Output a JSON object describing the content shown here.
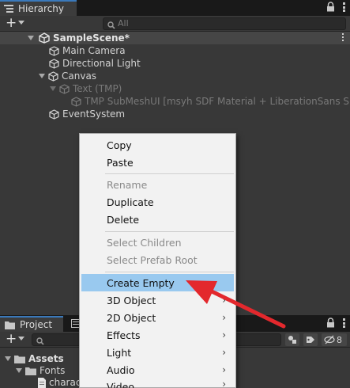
{
  "hierarchy": {
    "tab_label": "Hierarchy",
    "search_placeholder": "All",
    "scene": "SampleScene*",
    "items": [
      {
        "label": "Main Camera"
      },
      {
        "label": "Directional Light"
      },
      {
        "label": "Canvas"
      },
      {
        "label": "Text (TMP)"
      },
      {
        "label": "TMP SubMeshUI [msyh SDF Material + LiberationSans SDF"
      },
      {
        "label": "EventSystem"
      }
    ]
  },
  "project": {
    "tab_label": "Project",
    "hidden_count": "8",
    "tree": [
      {
        "label": "Assets"
      },
      {
        "label": "Fonts"
      },
      {
        "label": "charac"
      }
    ]
  },
  "context_menu": {
    "items": [
      {
        "label": "Copy",
        "enabled": true
      },
      {
        "label": "Paste",
        "enabled": true
      },
      {
        "label": "Rename",
        "enabled": false
      },
      {
        "label": "Duplicate",
        "enabled": true
      },
      {
        "label": "Delete",
        "enabled": true
      },
      {
        "label": "Select Children",
        "enabled": false
      },
      {
        "label": "Select Prefab Root",
        "enabled": false
      },
      {
        "label": "Create Empty",
        "enabled": true,
        "highlighted": true
      },
      {
        "label": "3D Object",
        "enabled": true,
        "submenu": true
      },
      {
        "label": "2D Object",
        "enabled": true,
        "submenu": true
      },
      {
        "label": "Effects",
        "enabled": true,
        "submenu": true
      },
      {
        "label": "Light",
        "enabled": true,
        "submenu": true
      },
      {
        "label": "Audio",
        "enabled": true,
        "submenu": true
      },
      {
        "label": "Video",
        "enabled": true,
        "submenu": true
      }
    ],
    "submenu_arrow": "›"
  },
  "colors": {
    "panel_bg": "#383838",
    "tab_bg": "#191919",
    "accent": "#3a79bb",
    "menu_bg": "#f2f2f2",
    "menu_highlight": "#99c9ef",
    "annotation_arrow": "#e3282d"
  },
  "icons": {
    "hierarchy_tab": "list-icon",
    "lock": "lock-icon",
    "more": "kebab-icon",
    "add": "plus-icon",
    "search": "search-icon",
    "scene": "unity-logo-icon",
    "gameobject": "cube-icon",
    "project_tab": "folder-icon",
    "folder": "folder-icon",
    "file": "file-icon",
    "filter": "filter-icon",
    "tag": "tag-icon",
    "hidden": "eye-slash-icon"
  }
}
